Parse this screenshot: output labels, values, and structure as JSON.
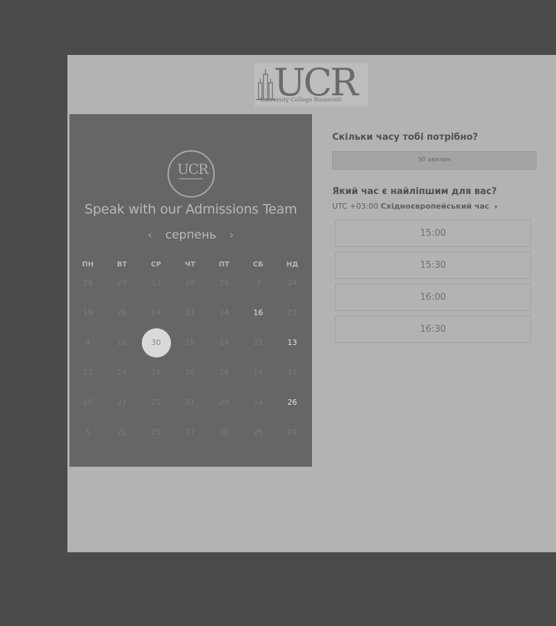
{
  "header": {
    "logo_text": "UCR",
    "logo_subtitle": "University College Roosevelt"
  },
  "left_panel": {
    "logo_text": "UCR",
    "headline": "Speak with our Admissions Team",
    "month": "серпень",
    "prev_icon": "‹",
    "next_icon": "›",
    "weekdays": [
      "ПН",
      "ВТ",
      "СР",
      "ЧТ",
      "ПТ",
      "СБ",
      "НД"
    ],
    "days": [
      [
        "28",
        "28",
        "13",
        "20",
        "28",
        "7",
        "24"
      ],
      [
        "19",
        "26",
        "14",
        "31",
        "14",
        "16",
        "27"
      ],
      [
        "4",
        "18",
        "30",
        "15",
        "14",
        "21",
        "13"
      ],
      [
        "17",
        "24",
        "18",
        "20",
        "28",
        "14",
        "21"
      ],
      [
        "15",
        "21",
        "25",
        "31",
        "29",
        "14",
        "26"
      ],
      [
        "5",
        "21",
        "25",
        "17",
        "30",
        "25",
        "19"
      ]
    ],
    "available_days": [
      "16",
      "13",
      "26"
    ],
    "selected_day": "30"
  },
  "right_panel": {
    "duration_question": "Скільки часу тобі потрібно?",
    "duration_value": "30 хвилин",
    "time_question": "Який час є найліпшим для вас?",
    "timezone_offset": "UTC +03:00",
    "timezone_name": "Східноєвропейський час",
    "timezone_caret": "▾",
    "time_slots": [
      "15:00",
      "15:30",
      "16:00",
      "16:30"
    ]
  }
}
